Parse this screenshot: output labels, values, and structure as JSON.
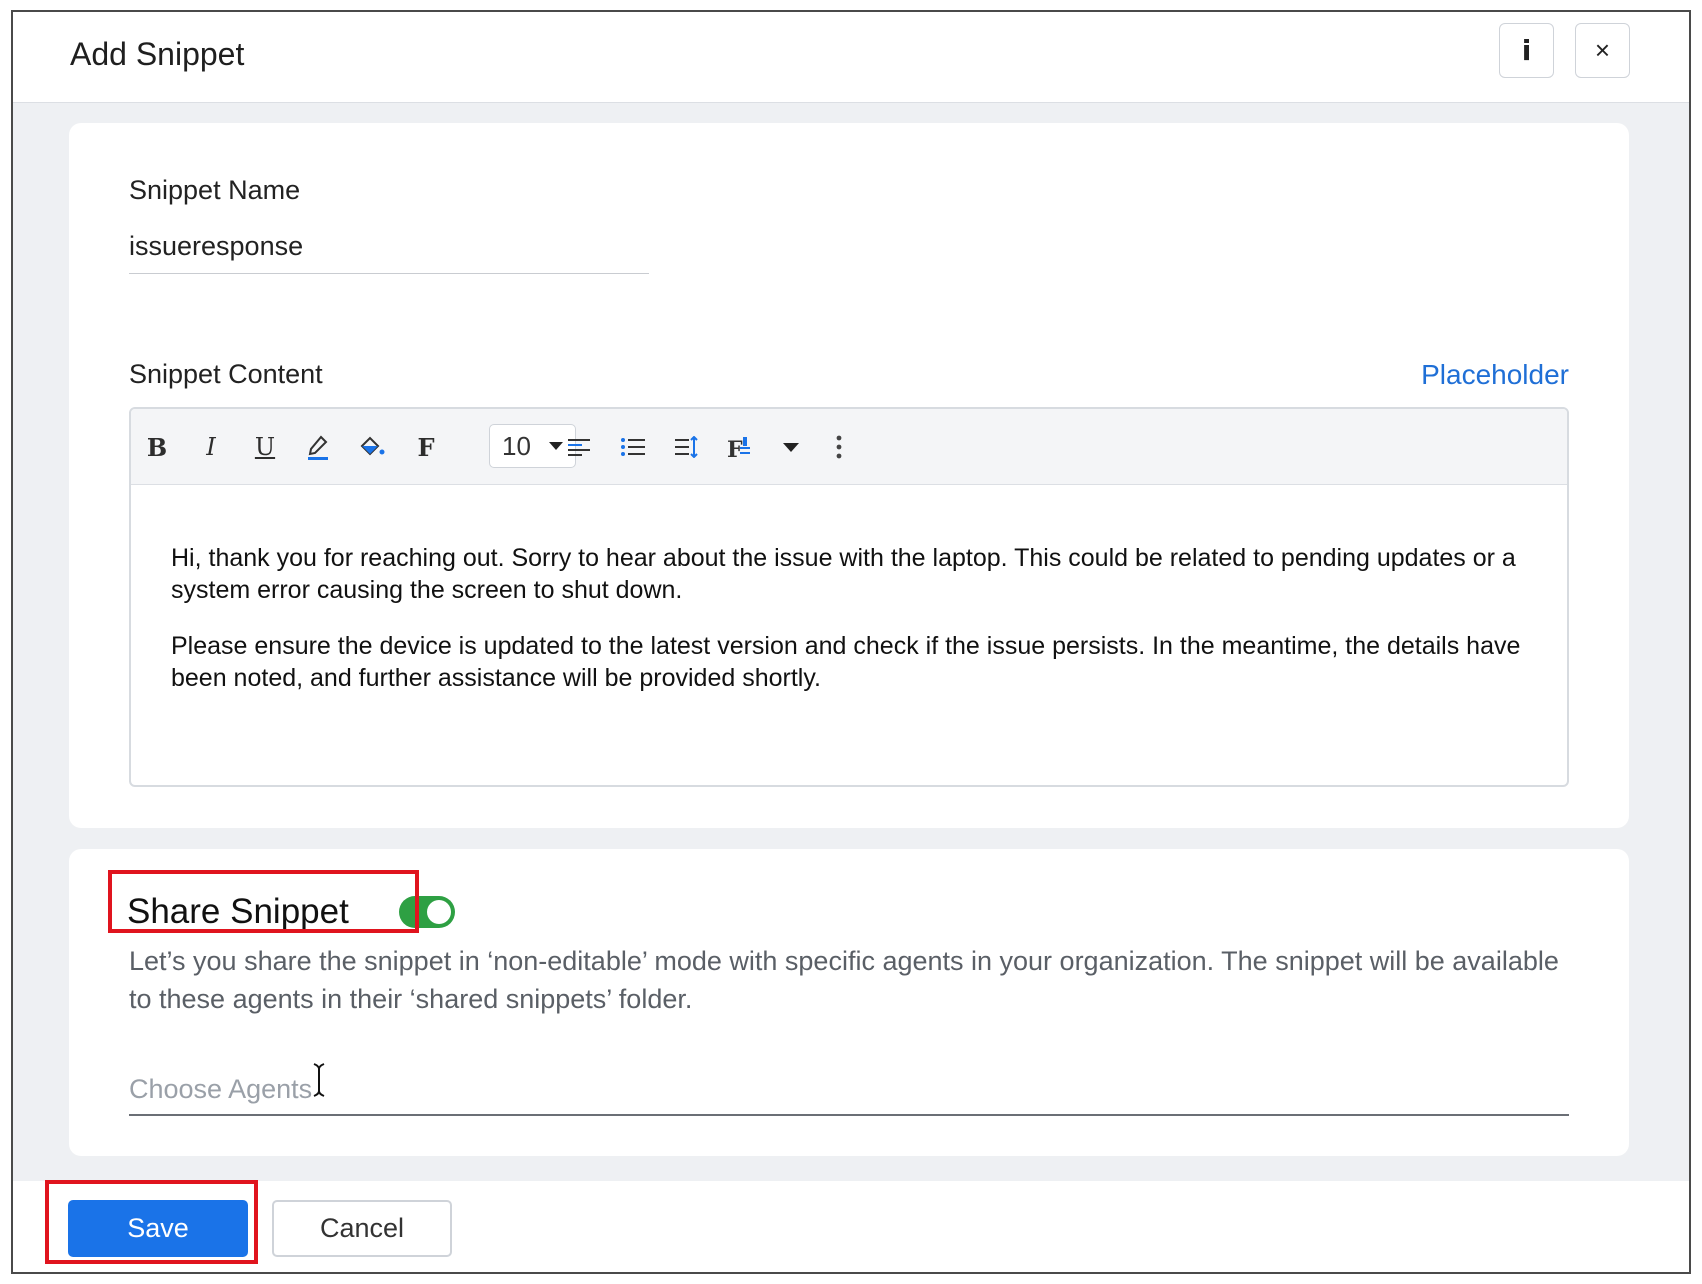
{
  "dialog": {
    "title": "Add Snippet",
    "info_label": "i",
    "close_label": "×"
  },
  "snippet_name": {
    "label": "Snippet Name",
    "value": "issueresponse"
  },
  "snippet_content": {
    "label": "Snippet Content",
    "placeholder_link": "Placeholder",
    "toolbar": {
      "bold": "B",
      "italic": "I",
      "underline": "U",
      "font": "F",
      "font_size": "10"
    },
    "paragraphs": [
      "Hi, thank you for reaching out. Sorry to hear about the issue with the laptop. This could be related to pending updates or a system error causing the screen to shut down.",
      "Please ensure the device is updated to the latest version and check if the issue persists. In the meantime, the details have been noted, and further assistance will be provided shortly."
    ]
  },
  "share": {
    "title": "Share Snippet",
    "enabled": true,
    "description": "Let’s you share the snippet in ‘non-editable’ mode with specific agents in your organization. The snippet will be available to these agents in their ‘shared snippets’ folder.",
    "agents_placeholder": "Choose Agents"
  },
  "footer": {
    "save_label": "Save",
    "cancel_label": "Cancel"
  },
  "colors": {
    "accent": "#1a73e8",
    "link": "#1f6fd6",
    "toggle_on": "#2ea043",
    "highlight": "#e0141e"
  }
}
